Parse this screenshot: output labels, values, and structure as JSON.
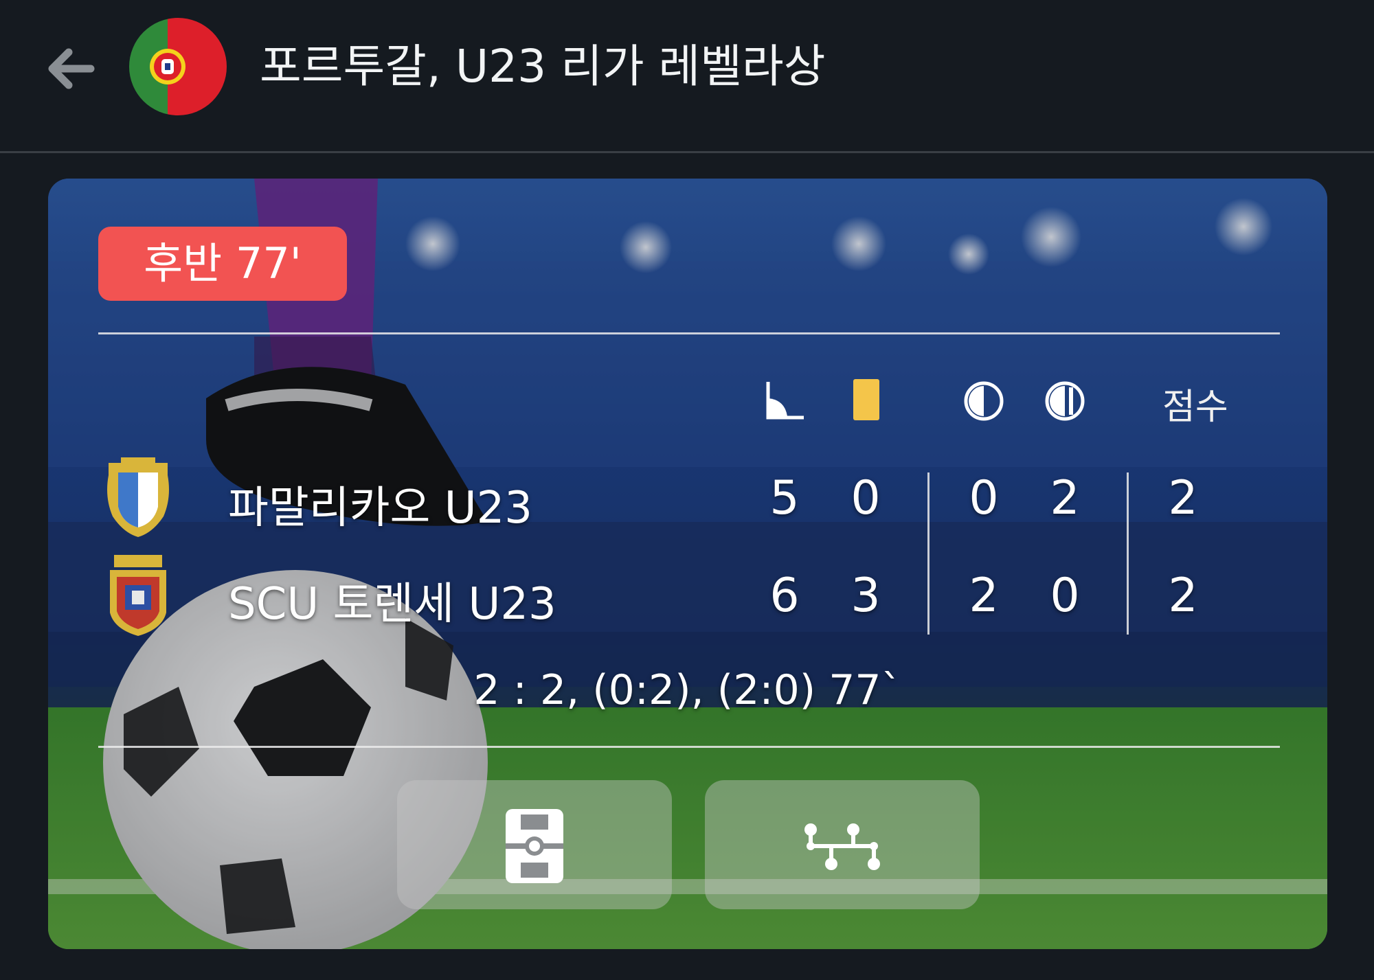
{
  "header": {
    "back_icon": "arrow-left-icon",
    "flag_icon": "portugal-flag-icon",
    "title": "포르투갈, U23 리가 레벨라상"
  },
  "match": {
    "status": "후반  77'",
    "status_color": "#f25352",
    "columns": {
      "corners_icon": "corner-flag-icon",
      "yellow_cards_icon": "yellow-card-icon",
      "first_half_icon": "first-half-icon",
      "second_half_icon": "second-half-icon",
      "score_label": "점수"
    },
    "teams": [
      {
        "name": "파말리카오 U23",
        "logo_icon": "famalicao-crest-icon",
        "corners": "5",
        "yellow_cards": "0",
        "first_half": "0",
        "second_half": "2",
        "score": "2"
      },
      {
        "name": "SCU 토렌세 U23",
        "logo_icon": "torreense-crest-icon",
        "corners": "6",
        "yellow_cards": "3",
        "first_half": "2",
        "second_half": "0",
        "score": "2"
      }
    ],
    "summary": "2 : 2, (0:2), (2:0) 77`",
    "yellow_card_color": "#f4c54a"
  },
  "actions": {
    "field_button_icon": "football-pitch-icon",
    "lineup_button_icon": "lineup-formation-icon"
  }
}
